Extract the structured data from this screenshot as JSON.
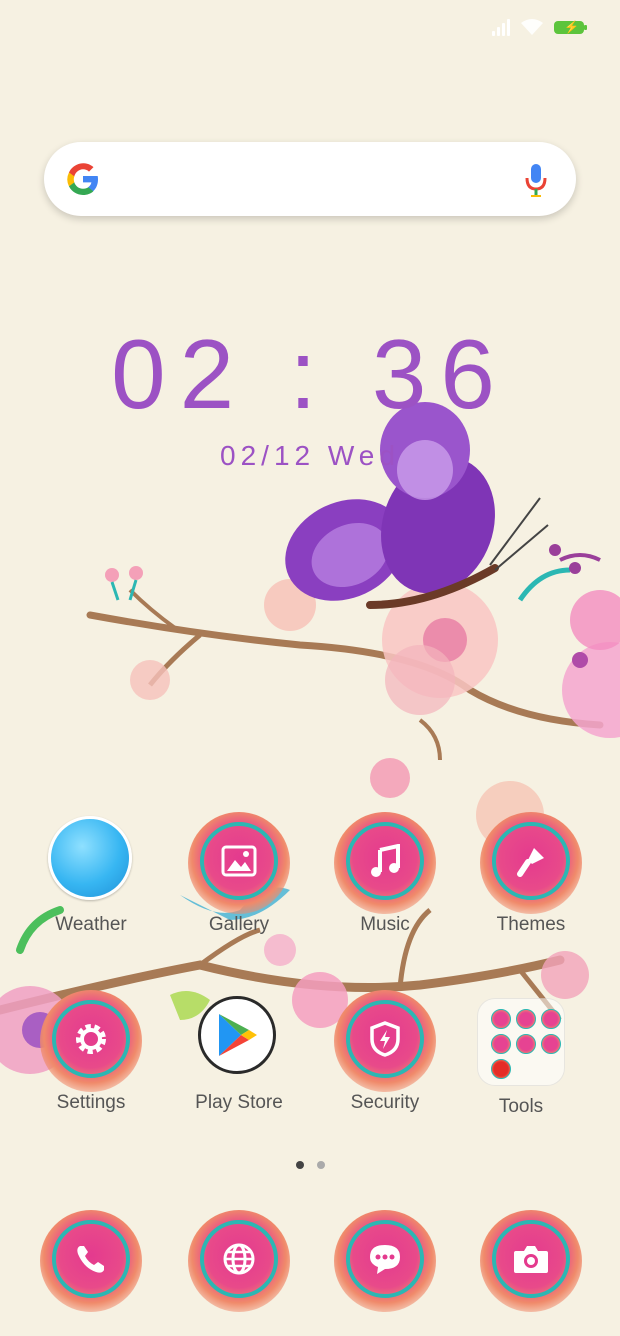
{
  "status_bar": {
    "icons": [
      "signal-icon",
      "wifi-icon",
      "battery-charging-icon"
    ],
    "battery_color": "#5cc43c"
  },
  "search": {
    "icons": [
      "google-g-icon",
      "microphone-icon"
    ]
  },
  "clock": {
    "time": "02 : 36",
    "date": "02/12  Wed",
    "color": "#9c52c4"
  },
  "apps": {
    "weather": "Weather",
    "gallery": "Gallery",
    "music": "Music",
    "themes": "Themes",
    "settings": "Settings",
    "play_store": "Play Store",
    "security": "Security",
    "tools": "Tools"
  },
  "dock": {
    "items": [
      "phone-icon",
      "browser-icon",
      "messages-icon",
      "camera-icon"
    ]
  },
  "pager": {
    "pages": 2,
    "current": 1
  },
  "theme": {
    "background": "#f6f1e2",
    "icon_ring": "#2bb7b3",
    "icon_fill": "#e43a8e"
  }
}
